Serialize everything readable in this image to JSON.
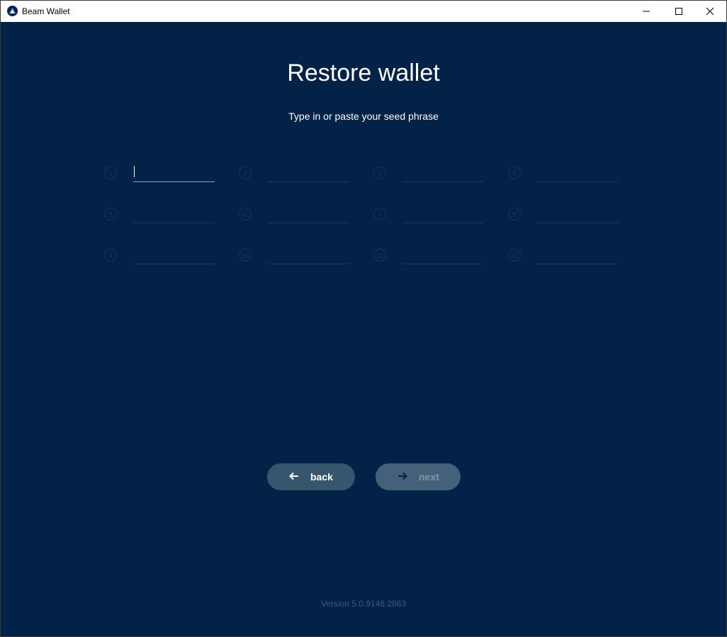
{
  "window": {
    "title": "Beam Wallet",
    "controls": [
      "minimize",
      "maximize",
      "close"
    ]
  },
  "page": {
    "title": "Restore wallet",
    "subtitle": "Type in or paste your seed phrase"
  },
  "seed": {
    "words": [
      {
        "number": "1",
        "value": ""
      },
      {
        "number": "2",
        "value": ""
      },
      {
        "number": "3",
        "value": ""
      },
      {
        "number": "4",
        "value": ""
      },
      {
        "number": "5",
        "value": ""
      },
      {
        "number": "6",
        "value": ""
      },
      {
        "number": "7",
        "value": ""
      },
      {
        "number": "8",
        "value": ""
      },
      {
        "number": "9",
        "value": ""
      },
      {
        "number": "10",
        "value": ""
      },
      {
        "number": "11",
        "value": ""
      },
      {
        "number": "12",
        "value": ""
      }
    ]
  },
  "buttons": {
    "back_label": "back",
    "next_label": "next"
  },
  "footer": {
    "version": "Version 5.0.9146.2863"
  },
  "colors": {
    "background": "#032248",
    "back_button": "#37566d",
    "next_button_disabled": "#45617a"
  },
  "icons": {
    "app": "beam-logo-icon",
    "back": "arrow-left-icon",
    "next": "arrow-right-icon"
  }
}
